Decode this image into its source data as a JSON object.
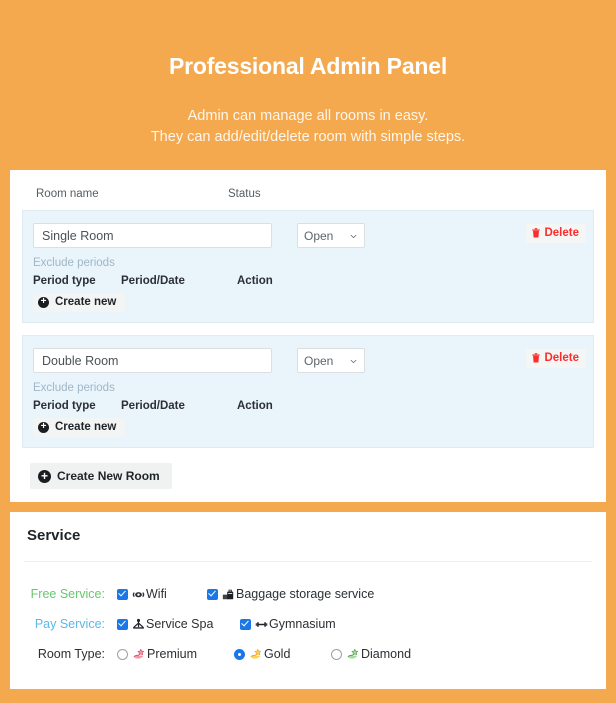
{
  "header": {
    "title": "Professional Admin Panel",
    "subtitle_line1": "Admin can manage all rooms in easy.",
    "subtitle_line2": "They can add/edit/delete room with simple steps."
  },
  "rooms_card": {
    "columns": {
      "room_name": "Room name",
      "status": "Status"
    },
    "period_columns": {
      "period_type": "Period type",
      "period_date": "Period/Date",
      "action": "Action"
    },
    "exclude_periods_label": "Exclude periods",
    "create_new_label": "Create new",
    "delete_label": "Delete",
    "create_new_room_label": "Create New Room",
    "rooms": [
      {
        "name": "Single Room",
        "status": "Open"
      },
      {
        "name": "Double Room",
        "status": "Open"
      }
    ]
  },
  "service_card": {
    "title": "Service",
    "rows": [
      {
        "label": "Free Service:",
        "type": "checkbox",
        "options": [
          {
            "text": "Wifi",
            "icon": "wifi-icon",
            "checked": true
          },
          {
            "text": "Baggage storage service",
            "icon": "baggage-icon",
            "checked": true
          }
        ]
      },
      {
        "label": "Pay Service:",
        "type": "checkbox",
        "options": [
          {
            "text": "Service Spa",
            "icon": "spa-icon",
            "checked": true
          },
          {
            "text": "Gymnasium",
            "icon": "dumbbell-icon",
            "checked": true
          }
        ]
      },
      {
        "label": "Room Type:",
        "type": "radio",
        "options": [
          {
            "text": "Premium",
            "icon": "hand-star-red-icon",
            "selected": false
          },
          {
            "text": "Gold",
            "icon": "hand-star-gold-icon",
            "selected": true
          },
          {
            "text": "Diamond",
            "icon": "hand-star-green-icon",
            "selected": false
          }
        ]
      }
    ]
  },
  "colors": {
    "page_background": "#f5a94e",
    "card_background": "#ffffff",
    "room_block_background": "#eaf4fb",
    "delete_red": "#fc2d2d",
    "free_service_green": "#64c86e",
    "pay_service_blue": "#5bb8e8",
    "checkbox_blue": "#1b77e8",
    "link_blue": "#9fb7c9"
  }
}
